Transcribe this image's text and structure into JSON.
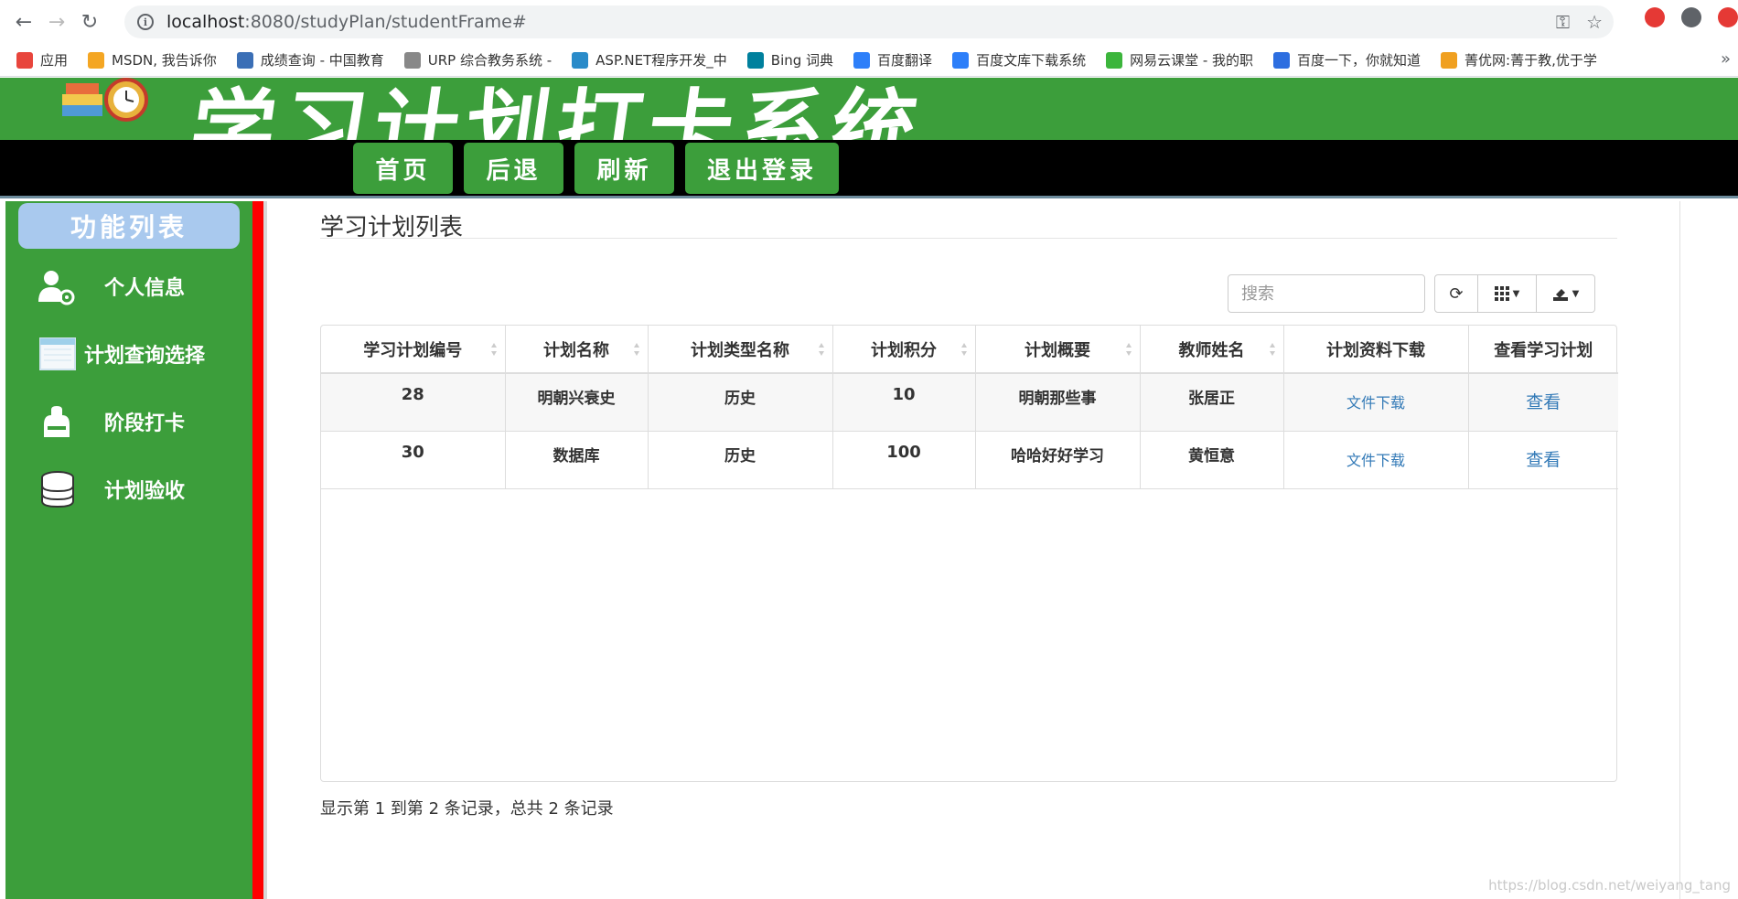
{
  "browser": {
    "url_host": "localhost",
    "url_path": ":8080/studyPlan/studentFrame#",
    "bookmarks": [
      {
        "label": "应用",
        "color": "#e8453c"
      },
      {
        "label": "MSDN, 我告诉你",
        "color": "#f4a623"
      },
      {
        "label": "成绩查询 - 中国教育",
        "color": "#3b6fb6"
      },
      {
        "label": "URP 综合教务系统 -",
        "color": "#888888"
      },
      {
        "label": "ASP.NET程序开发_中",
        "color": "#2a8bc9"
      },
      {
        "label": "Bing 词典",
        "color": "#00809d"
      },
      {
        "label": "百度翻译",
        "color": "#2d7ff9"
      },
      {
        "label": "百度文库下载系统",
        "color": "#2d7ff9"
      },
      {
        "label": "网易云课堂 - 我的职",
        "color": "#3cb53c"
      },
      {
        "label": "百度一下，你就知道",
        "color": "#2d6ee0"
      },
      {
        "label": "菁优网:菁于教,优于学",
        "color": "#f0a020"
      }
    ],
    "more": "»"
  },
  "app": {
    "title": "学习计划打卡系统",
    "nav": [
      {
        "label": "首页"
      },
      {
        "label": "后退"
      },
      {
        "label": "刷新"
      },
      {
        "label": "退出登录"
      }
    ]
  },
  "sidebar": {
    "header": "功能列表",
    "items": [
      {
        "label": "个人信息",
        "icon": "user-gear-icon"
      },
      {
        "label": "计划查询选择",
        "icon": "calendar-icon"
      },
      {
        "label": "阶段打卡",
        "icon": "punch-icon"
      },
      {
        "label": "计划验收",
        "icon": "database-icon"
      }
    ]
  },
  "main": {
    "title": "学习计划列表",
    "search_placeholder": "搜索",
    "columns": [
      "学习计划编号",
      "计划名称",
      "计划类型名称",
      "计划积分",
      "计划概要",
      "教师姓名",
      "计划资料下载",
      "查看学习计划"
    ],
    "rows": [
      {
        "id": "28",
        "name": "明朝兴衰史",
        "type": "历史",
        "points": "10",
        "summary": "明朝那些事",
        "teacher": "张居正",
        "download": "文件下载",
        "view": "查看"
      },
      {
        "id": "30",
        "name": "数据库",
        "type": "历史",
        "points": "100",
        "summary": "哈哈好好学习",
        "teacher": "黄恒意",
        "download": "文件下载",
        "view": "查看"
      }
    ],
    "pager": "显示第 1 到第 2 条记录，总共 2 条记录"
  },
  "watermark": "https://blog.csdn.net/weiyang_tang"
}
